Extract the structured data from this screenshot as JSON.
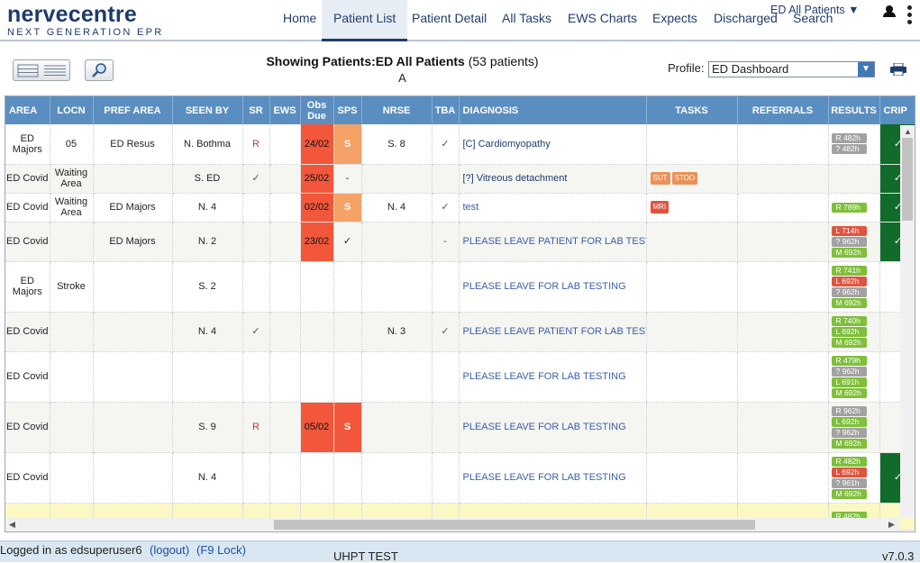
{
  "brand": {
    "name": "nervecentre",
    "tagline": "NEXT GENERATION EPR"
  },
  "nav": [
    "Home",
    "Patient List",
    "Patient Detail",
    "All Tasks",
    "EWS Charts",
    "Expects",
    "Discharged",
    "Search"
  ],
  "ward_selector": "ED All Patients",
  "toolbar": {
    "showing_prefix": "Showing Patients:",
    "showing_list": "ED All Patients",
    "showing_count": "(53 patients)",
    "filter": "A",
    "profile_label": "Profile:",
    "profile_value": "ED Dashboard"
  },
  "columns": [
    "AREA",
    "LOCN",
    "PREF AREA",
    "SEEN BY",
    "SR",
    "EWS",
    "Obs Due",
    "SPS",
    "NRSE",
    "TBA",
    "DIAGNOSIS",
    "TASKS",
    "REFERRALS",
    "RESULTS",
    "CRIP"
  ],
  "rows": [
    {
      "area": "ED Majors",
      "locn": "05",
      "pref": "ED Resus",
      "seen": "N. Bothma",
      "sr": "R",
      "ews": "",
      "obs": "24/02",
      "sps": "S",
      "nrse": "S. 8",
      "tba": "✓",
      "diag": "[C] Cardiomyopathy",
      "tasks": [],
      "results": [
        "R 482h",
        "? 482h"
      ],
      "crip": "✓"
    },
    {
      "area": "ED Covid",
      "locn": "Waiting Area",
      "pref": "",
      "seen": "S. ED",
      "sr": "✓",
      "ews": "",
      "obs": "25/02",
      "sps": "-",
      "nrse": "",
      "tba": "",
      "diag": "[?] Vitreous detachment",
      "tasks": [
        "SUT",
        "STOO"
      ],
      "results": [],
      "crip": "✓"
    },
    {
      "area": "ED Covid",
      "locn": "Waiting Area",
      "pref": "ED Majors",
      "seen": "N. 4",
      "sr": "",
      "ews": "",
      "obs": "02/02",
      "sps": "S",
      "nrse": "N. 4",
      "tba": "✓",
      "diag": "test",
      "tasks": [
        "MRI"
      ],
      "results": [
        "R 789h"
      ],
      "crip": "✓"
    },
    {
      "area": "ED Covid",
      "locn": "",
      "pref": "ED Majors",
      "seen": "N. 2",
      "sr": "",
      "ews": "",
      "obs": "23/02",
      "sps": "✓",
      "nrse": "",
      "tba": "-",
      "diag": "PLEASE LEAVE PATIENT FOR LAB TESTING",
      "tasks": [],
      "results": [
        "L 714h",
        "? 962h",
        "M 692h"
      ],
      "crip": "✓"
    },
    {
      "area": "ED Majors",
      "locn": "Stroke",
      "pref": "",
      "seen": "S. 2",
      "sr": "",
      "ews": "",
      "obs": "",
      "sps": "",
      "nrse": "",
      "tba": "",
      "diag": "PLEASE LEAVE FOR LAB TESTING",
      "tasks": [],
      "results": [
        "R 741h",
        "L 692h",
        "? 962h",
        "M 692h"
      ],
      "crip": ""
    },
    {
      "area": "ED Covid",
      "locn": "",
      "pref": "",
      "seen": "N. 4",
      "sr": "✓",
      "ews": "",
      "obs": "",
      "sps": "",
      "nrse": "N. 3",
      "tba": "✓",
      "diag": "PLEASE LEAVE PATIENT FOR LAB TESTING",
      "tasks": [],
      "results": [
        "R 740h",
        "L 692h",
        "M 692h"
      ],
      "crip": ""
    },
    {
      "area": "ED Covid",
      "locn": "",
      "pref": "",
      "seen": "",
      "sr": "",
      "ews": "",
      "obs": "",
      "sps": "",
      "nrse": "",
      "tba": "",
      "diag": "PLEASE LEAVE FOR LAB TESTING",
      "tasks": [],
      "results": [
        "R 479h",
        "? 962h",
        "L 691h",
        "M 692h"
      ],
      "crip": ""
    },
    {
      "area": "ED Covid",
      "locn": "",
      "pref": "",
      "seen": "S. 9",
      "sr": "R",
      "ews": "",
      "obs": "05/02",
      "sps": "S",
      "nrse": "",
      "tba": "",
      "diag": "PLEASE LEAVE FOR LAB TESTING",
      "tasks": [],
      "results": [
        "R 962h",
        "L 692h",
        "? 962h",
        "M 692h"
      ],
      "crip": ""
    },
    {
      "area": "ED Covid",
      "locn": "",
      "pref": "",
      "seen": "N. 4",
      "sr": "",
      "ews": "",
      "obs": "",
      "sps": "",
      "nrse": "",
      "tba": "",
      "diag": "PLEASE LEAVE FOR LAB TESTING",
      "tasks": [],
      "results": [
        "R 482h",
        "L 692h",
        "? 961h",
        "M 692h"
      ],
      "crip": "✓"
    },
    {
      "area": "",
      "locn": "",
      "pref": "",
      "seen": "",
      "sr": "",
      "ews": "",
      "obs": "",
      "sps": "",
      "nrse": "",
      "tba": "",
      "diag": "",
      "tasks": [],
      "results": [
        "R 482h"
      ],
      "crip": ""
    }
  ],
  "footer": {
    "logged_in_prefix": "Logged in as edsuperuser6",
    "logout": "(logout)",
    "lock": "(F9 Lock)",
    "environment": "UHPT TEST",
    "version": "v7.0.3"
  }
}
